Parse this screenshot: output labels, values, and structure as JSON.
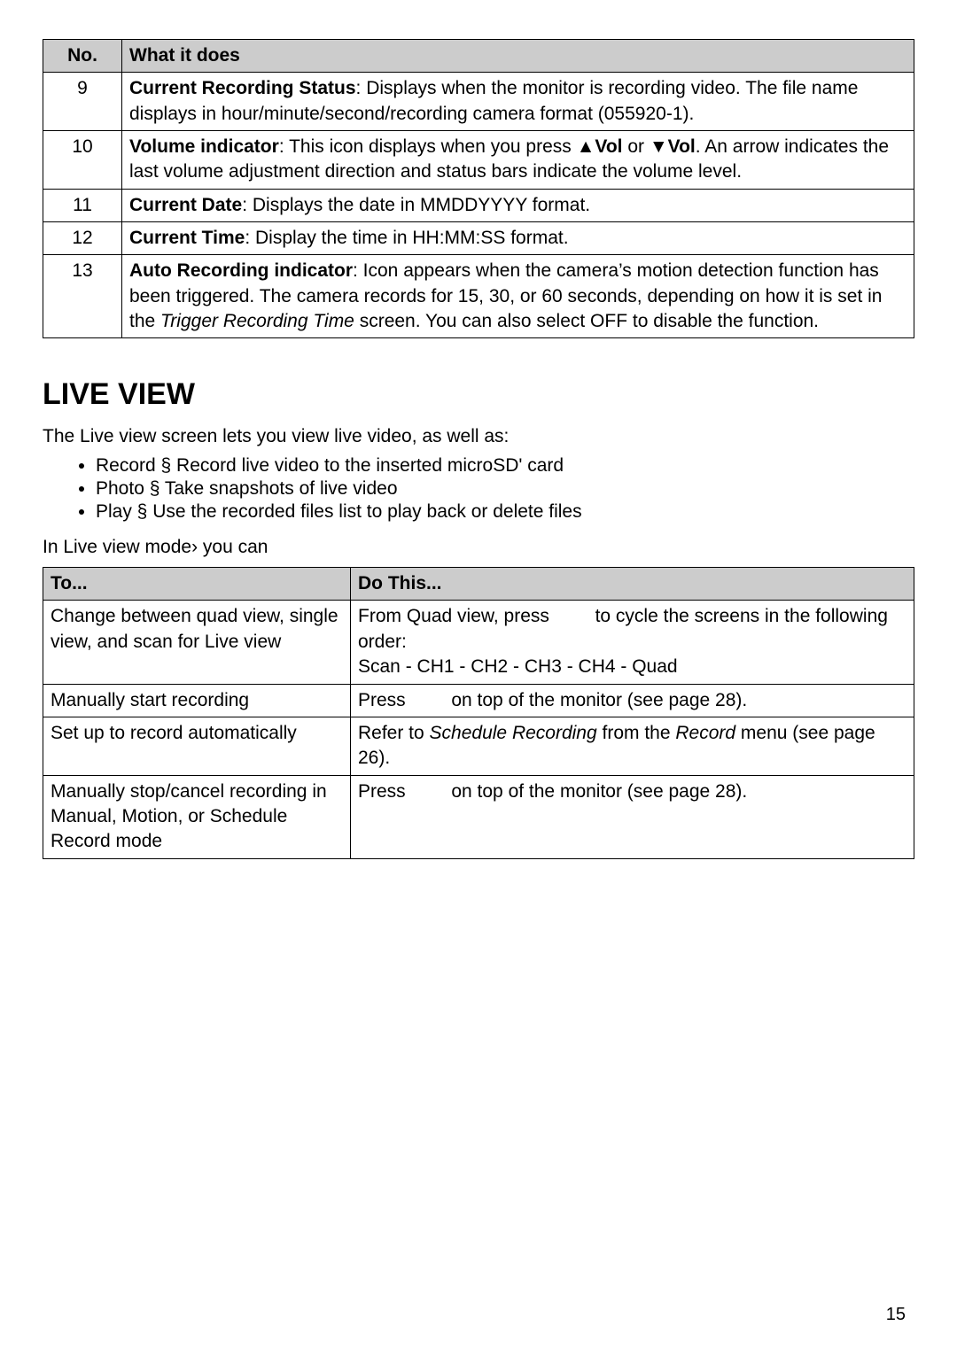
{
  "table1": {
    "header": {
      "no": "No.",
      "what": "What it does"
    },
    "rows": [
      {
        "no": "9",
        "label": "Current Recording Status",
        "desc": ": Displays when the monitor is recording video. The file name displays in hour/minute/second/recording camera format (055920-1)."
      },
      {
        "no": "10",
        "label": "Volume indicator",
        "desc_pre": ": This icon displays when you press ",
        "vol_up": "▲Vol ",
        "mid": " or ",
        "vol_dn": "▼Vol",
        "desc_post": ". An arrow indicates the last volume adjustment direction and status bars indicate the volume level."
      },
      {
        "no": "11",
        "label": "Current Date",
        "desc": ": Displays the date in MMDDYYYY format."
      },
      {
        "no": "12",
        "label": "Current Time",
        "desc": ": Display the time in HH:MM:SS format."
      },
      {
        "no": "13",
        "label": "Auto Recording indicator",
        "desc_pre": ": Icon appears when the camera’s motion detection function has been triggered. The camera records for 15, 30, or 60 seconds, depending on how it is set in the ",
        "desc_it": "Trigger Recording Time",
        "desc_post": " screen. You can also select OFF to disable the function."
      }
    ]
  },
  "section": {
    "heading": "LIVE VIEW",
    "intro": "The Live view screen lets you view live video, as well as:",
    "bullets": [
      "Record § Record live video to the inserted microSD' card",
      "Photo § Take snapshots of live video",
      "Play § Use the recorded files list to play back or delete files"
    ],
    "lead_in": "In Live view mode› you can"
  },
  "table2": {
    "header": {
      "to": "To...",
      "do": "Do This..."
    },
    "rows": [
      {
        "to": "Change between quad view, single view, and scan for Live view",
        "do_pre": "From Quad view, press ",
        "do_mid": " to cycle the screens in the following order:",
        "do_line2": "Scan - CH1 - CH2 - CH3 - CH4 - Quad"
      },
      {
        "to": "Manually start recording",
        "do_pre": "Press ",
        "do_post": " on top of the monitor (see page 28)."
      },
      {
        "to": "Set up to record automatically",
        "do_pre": "Refer to ",
        "do_it1": "Schedule Recording",
        "do_mid": " from the ",
        "do_it2": "Record",
        "do_post": " menu (see page 26)."
      },
      {
        "to": "Manually stop/cancel recording in Manual, Motion, or Schedule Record mode",
        "do_pre": "Press ",
        "do_post": " on top of the monitor (see page 28)."
      }
    ]
  },
  "page_number": "15"
}
